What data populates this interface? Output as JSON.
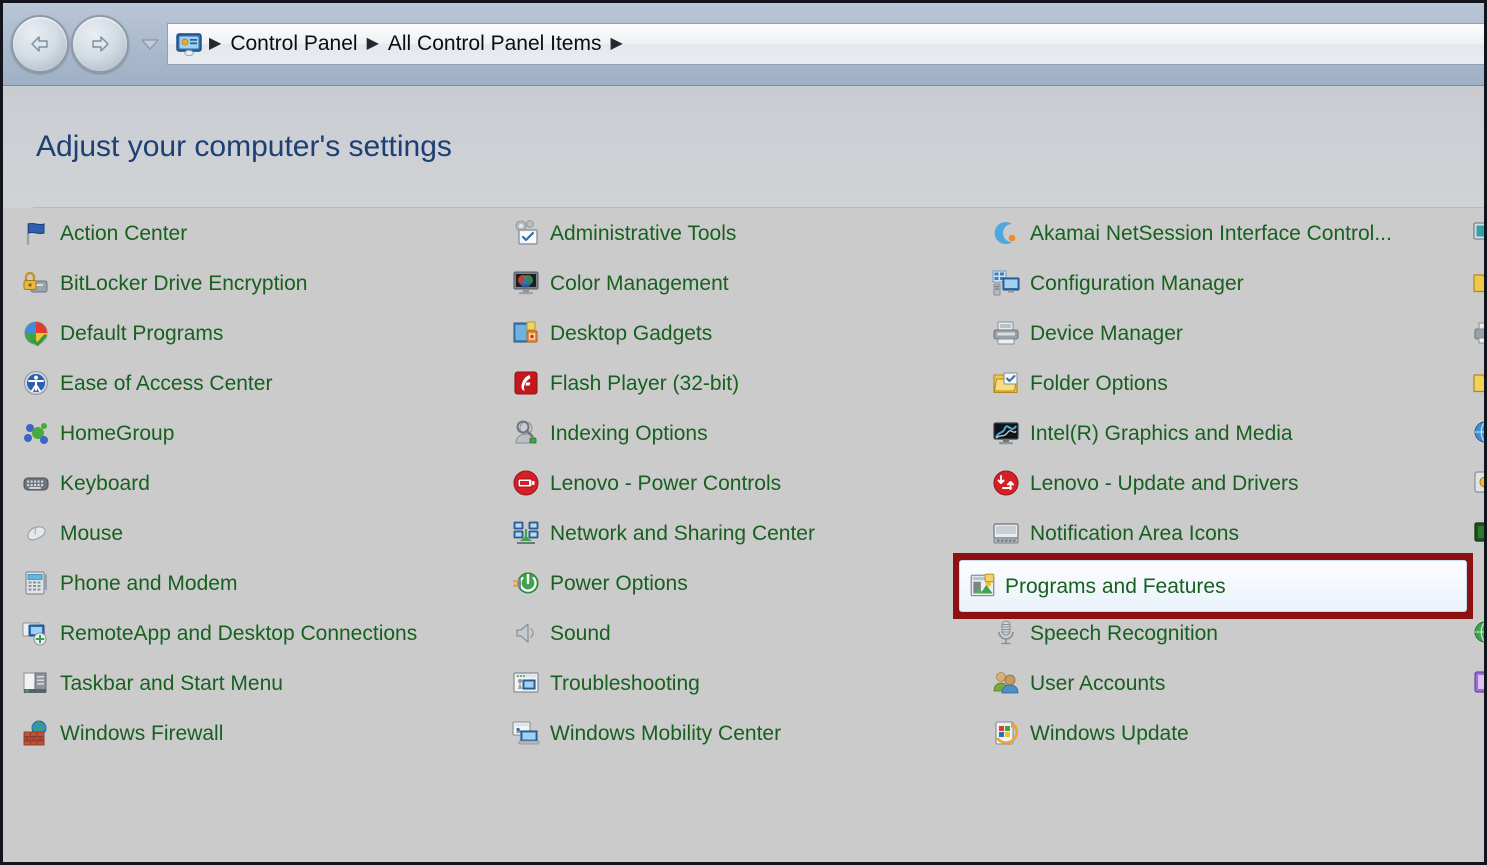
{
  "window": {
    "nav": {
      "back_label": "Back",
      "forward_label": "Forward",
      "history_label": "Recent pages",
      "back_icon": "arrow-left-icon",
      "forward_icon": "arrow-right-icon",
      "history_icon": "chevron-down-icon"
    },
    "address": {
      "icon": "control-panel-icon",
      "crumbs": [
        "Control Panel",
        "All Control Panel Items"
      ],
      "separator": "▶",
      "trailing_separator": "▶"
    }
  },
  "header": {
    "title": "Adjust your computer's settings"
  },
  "colors": {
    "item_text": "#17601f",
    "title_text": "#1e3f73",
    "highlight_border": "#8c1212",
    "page_background": "#cbcbcb",
    "chrome_background": "#aebdcf"
  },
  "highlight": {
    "target_label": "Programs and Features",
    "border_color": "#8c1212",
    "note": "red rectangle annotation around Programs and Features"
  },
  "columns": [
    {
      "name": "column-1",
      "items": [
        {
          "label": "Action Center",
          "icon": "flag-icon"
        },
        {
          "label": "BitLocker Drive Encryption",
          "icon": "lock-drive-icon"
        },
        {
          "label": "Default Programs",
          "icon": "default-programs-icon"
        },
        {
          "label": "Ease of Access Center",
          "icon": "ease-of-access-icon"
        },
        {
          "label": "HomeGroup",
          "icon": "homegroup-icon"
        },
        {
          "label": "Keyboard",
          "icon": "keyboard-icon"
        },
        {
          "label": "Mouse",
          "icon": "mouse-icon"
        },
        {
          "label": "Phone and Modem",
          "icon": "phone-modem-icon"
        },
        {
          "label": "RemoteApp and Desktop Connections",
          "icon": "remoteapp-icon"
        },
        {
          "label": "Taskbar and Start Menu",
          "icon": "taskbar-icon"
        },
        {
          "label": "Windows Firewall",
          "icon": "firewall-icon"
        }
      ]
    },
    {
      "name": "column-2",
      "items": [
        {
          "label": "Administrative Tools",
          "icon": "admin-tools-icon"
        },
        {
          "label": "Color Management",
          "icon": "color-management-icon"
        },
        {
          "label": "Desktop Gadgets",
          "icon": "desktop-gadgets-icon"
        },
        {
          "label": "Flash Player (32-bit)",
          "icon": "flash-player-icon"
        },
        {
          "label": "Indexing Options",
          "icon": "indexing-options-icon"
        },
        {
          "label": "Lenovo - Power Controls",
          "icon": "lenovo-power-icon"
        },
        {
          "label": "Network and Sharing Center",
          "icon": "network-sharing-icon"
        },
        {
          "label": "Power Options",
          "icon": "power-options-icon"
        },
        {
          "label": "Sound",
          "icon": "speaker-icon"
        },
        {
          "label": "Troubleshooting",
          "icon": "troubleshooting-icon"
        },
        {
          "label": "Windows Mobility Center",
          "icon": "mobility-center-icon"
        }
      ]
    },
    {
      "name": "column-3",
      "items": [
        {
          "label": "Akamai NetSession Interface Control...",
          "icon": "akamai-icon"
        },
        {
          "label": "Configuration Manager",
          "icon": "configuration-manager-icon"
        },
        {
          "label": "Device Manager",
          "icon": "device-manager-icon"
        },
        {
          "label": "Folder Options",
          "icon": "folder-options-icon"
        },
        {
          "label": "Intel(R) Graphics and Media",
          "icon": "intel-graphics-icon"
        },
        {
          "label": "Lenovo - Update and Drivers",
          "icon": "lenovo-update-icon"
        },
        {
          "label": "Notification Area Icons",
          "icon": "notification-area-icon"
        },
        {
          "label": "Programs and Features",
          "icon": "programs-features-icon"
        },
        {
          "label": "Speech Recognition",
          "icon": "microphone-icon"
        },
        {
          "label": "User Accounts",
          "icon": "user-accounts-icon"
        },
        {
          "label": "Windows Update",
          "icon": "windows-update-icon"
        }
      ]
    },
    {
      "name": "column-4-clipped",
      "items": [
        {
          "label": "",
          "icon": "display-icon"
        },
        {
          "label": "",
          "icon": "folder-icon"
        },
        {
          "label": "",
          "icon": "devices-printers-icon"
        },
        {
          "label": "",
          "icon": "folder-yellow-icon"
        },
        {
          "label": "",
          "icon": "internet-options-icon"
        },
        {
          "label": "",
          "icon": "location-sensors-icon"
        },
        {
          "label": "",
          "icon": "dark-green-icon"
        },
        {
          "label": "",
          "icon": "recovery-icon"
        },
        {
          "label": "",
          "icon": "globe-icon"
        },
        {
          "label": "",
          "icon": "personalization-icon"
        }
      ]
    }
  ]
}
